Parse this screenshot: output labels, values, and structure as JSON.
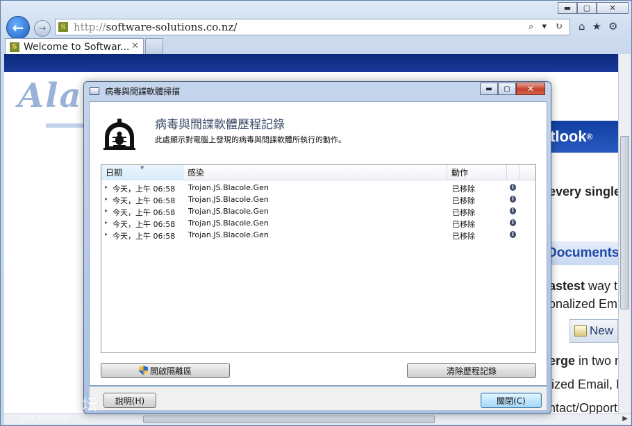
{
  "browser": {
    "window_controls": {
      "minimize": "▬",
      "maximize": "▢",
      "close": "✕"
    },
    "back_icon": "←",
    "forward_icon": "→",
    "address": {
      "protocol": "http://",
      "host": "software-solutions.co.nz/"
    },
    "address_tools": "⌕ ▾ ↻",
    "toolbar_icons": {
      "home": "⌂",
      "favorites": "★",
      "settings": "⚙"
    },
    "tab": {
      "title": "Welcome to Softwar...",
      "close": "✕"
    },
    "favicon_letter": "S"
  },
  "page": {
    "logo_text": "Alabh",
    "outlook_text": "tlook",
    "outlook_reg": "®",
    "line1": "every single",
    "documents_text": "Documents",
    "fastest_bold": "astest",
    "fastest_rest": " way t",
    "personalized": "onalized Em",
    "new_button": "New",
    "merge_bold": "erge",
    "merge_rest": " in two n",
    "lized_email": "lized Email, D",
    "contact": "ntact/Opport"
  },
  "dialog": {
    "title": "病毒與間諜軟體掃描",
    "controls": {
      "minimize": "▬",
      "maximize": "▢",
      "close": "✕"
    },
    "header_title": "病毒與間諜軟體歷程記錄",
    "header_desc": "此處顯示對電腦上發現的病毒與間諜軟體所執行的動作。",
    "columns": {
      "date": "日期",
      "infection": "感染",
      "action": "動作"
    },
    "rows": [
      {
        "date": "今天，上午 06:58",
        "infection": "Trojan.JS.Blacole.Gen",
        "action": "已移除"
      },
      {
        "date": "今天，上午 06:58",
        "infection": "Trojan.JS.Blacole.Gen",
        "action": "已移除"
      },
      {
        "date": "今天，上午 06:58",
        "infection": "Trojan.JS.Blacole.Gen",
        "action": "已移除"
      },
      {
        "date": "今天，上午 06:58",
        "infection": "Trojan.JS.Blacole.Gen",
        "action": "已移除"
      },
      {
        "date": "今天，上午 06:58",
        "infection": "Trojan.JS.Blacole.Gen",
        "action": "已移除"
      }
    ],
    "row_expander": "▸",
    "row_info": "i",
    "buttons": {
      "quarantine": "開啟隔離區",
      "clear_history": "清除歷程記錄",
      "help": "說明(H)",
      "close": "關閉(C)"
    }
  },
  "watermark": {
    "main": "卡饭论坛",
    "sub": "bbs.kafan.cn"
  }
}
